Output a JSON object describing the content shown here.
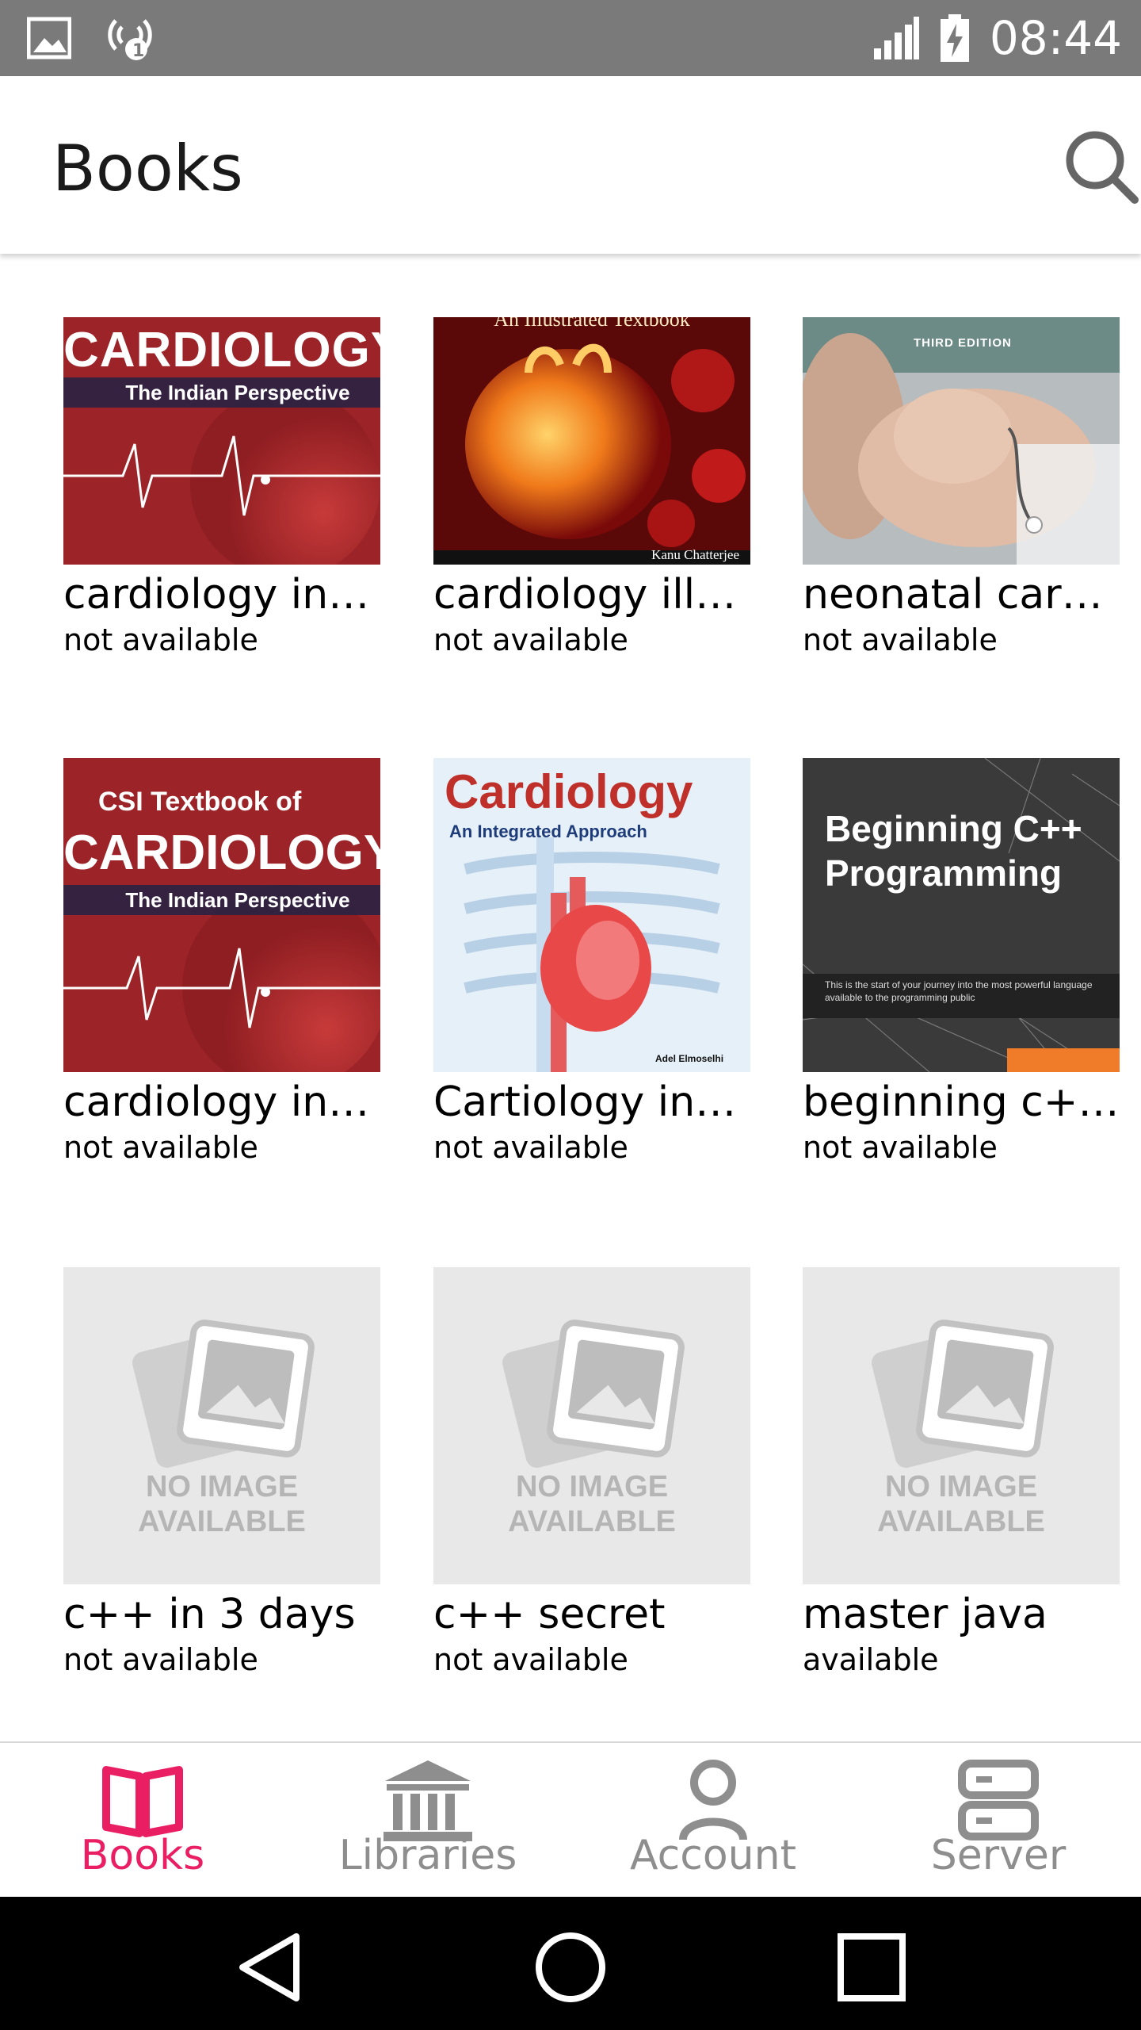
{
  "status_bar": {
    "time": "08:44",
    "icons": [
      "image-icon",
      "wifi-hotspot-icon",
      "signal-icon",
      "battery-charging-icon"
    ]
  },
  "app_bar": {
    "title": "Books",
    "search_icon": "search-icon"
  },
  "books": [
    {
      "title": "cardiology in…",
      "status": "not available",
      "cover": {
        "line1": "CARDIOLOGY",
        "line2": "The Indian Perspective"
      }
    },
    {
      "title": "cardiology ill…",
      "status": "not available",
      "cover": {
        "line1": "An Illustrated Textbook",
        "author": "Kanu Chatterjee"
      }
    },
    {
      "title": "neonatal car…",
      "status": "not available",
      "cover": {
        "edition": "THIRD EDITION"
      }
    },
    {
      "title": "cardiology in…",
      "status": "not available",
      "cover": {
        "line0": "CSI Textbook of",
        "line1": "CARDIOLOGY",
        "line2": "The Indian Perspective"
      }
    },
    {
      "title": "Cartiology in…",
      "status": "not available",
      "cover": {
        "line1": "Cardiology",
        "line2": "An Integrated Approach",
        "author": "Adel Elmoselhi"
      }
    },
    {
      "title": "beginning c+…",
      "status": "not available",
      "cover": {
        "line1": "Beginning C++",
        "line2": "Programming",
        "blurb": "This is the start of your journey into the most powerful language available to the programming public"
      }
    },
    {
      "title": "c++ in 3 days",
      "status": "not available",
      "cover": {
        "placeholder": "NO IMAGE AVAILABLE"
      }
    },
    {
      "title": "c++ secret",
      "status": "not available",
      "cover": {
        "placeholder": "NO IMAGE AVAILABLE"
      }
    },
    {
      "title": "master java",
      "status": "available",
      "cover": {
        "placeholder": "NO IMAGE AVAILABLE"
      }
    }
  ],
  "bottom_nav": {
    "items": [
      {
        "label": "Books",
        "icon": "open-book-icon",
        "active": true
      },
      {
        "label": "Libraries",
        "icon": "library-building-icon",
        "active": false
      },
      {
        "label": "Account",
        "icon": "person-icon",
        "active": false
      },
      {
        "label": "Server",
        "icon": "server-icon",
        "active": false
      }
    ]
  },
  "system_nav": {
    "icons": [
      "back-icon",
      "home-icon",
      "recents-icon"
    ]
  },
  "colors": {
    "accent": "#e91e63",
    "inactive": "#8e8e8e",
    "status_bar": "#7a7a7a"
  }
}
